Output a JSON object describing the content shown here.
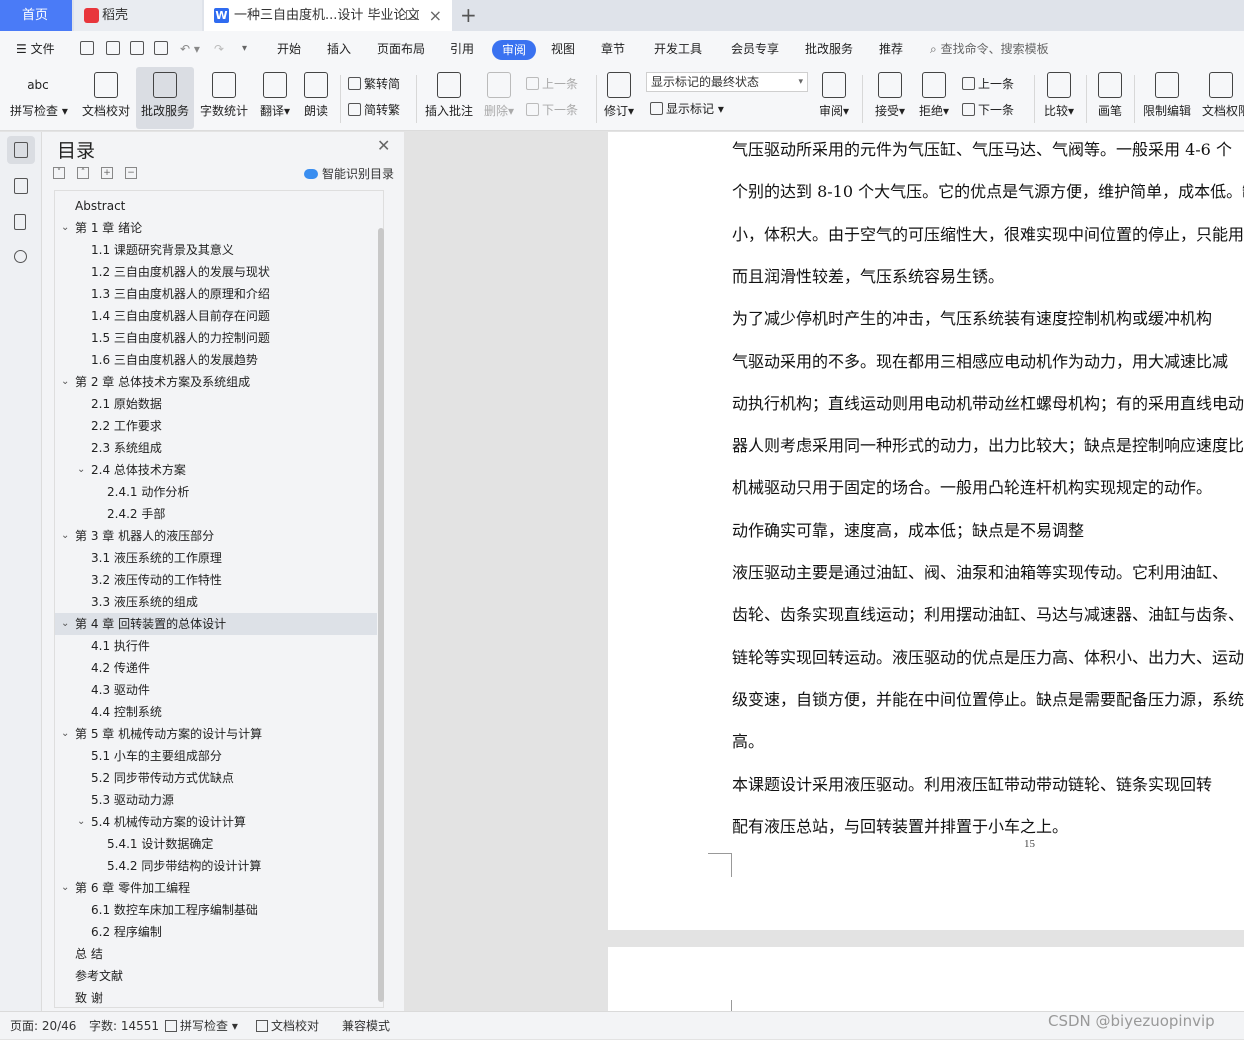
{
  "tabs": {
    "home": "首页",
    "daoke": "稻壳",
    "doc": "一种三自由度机...设计 毕业论文"
  },
  "menu": {
    "file": "文件",
    "items": [
      "开始",
      "插入",
      "页面布局",
      "引用",
      "审阅",
      "视图",
      "章节",
      "开发工具",
      "会员专享",
      "批改服务",
      "推荐"
    ],
    "active_index": 4,
    "search_placeholder": "查找命令、搜索模板"
  },
  "ribbon": {
    "spell": "拼写检查",
    "proof": "文档校对",
    "correct": "批改服务",
    "wordcount": "字数统计",
    "translate": "翻译",
    "read": "朗读",
    "s2t": "繁转简",
    "t2s": "简转繁",
    "insert_comment": "插入批注",
    "delete": "删除",
    "prev": "上一条",
    "next": "下一条",
    "revise": "修订",
    "markup_state": "显示标记的最终状态",
    "show_markup": "显示标记",
    "review": "审阅",
    "accept": "接受",
    "reject": "拒绝",
    "prev2": "上一条",
    "next2": "下一条",
    "compare": "比较",
    "pen": "画笔",
    "restrict": "限制编辑",
    "doc_perm": "文档权限"
  },
  "toc": {
    "title": "目录",
    "smart": "智能识别目录",
    "items": [
      {
        "text": "Abstract",
        "level": 0,
        "arrow": ""
      },
      {
        "text": "第 1 章  绪论",
        "level": 0,
        "arrow": "v"
      },
      {
        "text": "1.1 课题研究背景及其意义",
        "level": 1,
        "arrow": ""
      },
      {
        "text": "1.2 三自由度机器人的发展与现状",
        "level": 1,
        "arrow": ""
      },
      {
        "text": "1.3 三自由度机器人的原理和介绍",
        "level": 1,
        "arrow": ""
      },
      {
        "text": "1.4 三自由度机器人目前存在问题",
        "level": 1,
        "arrow": ""
      },
      {
        "text": "1.5 三自由度机器人的力控制问题",
        "level": 1,
        "arrow": ""
      },
      {
        "text": "1.6 三自由度机器人的发展趋势",
        "level": 1,
        "arrow": ""
      },
      {
        "text": "第 2 章  总体技术方案及系统组成",
        "level": 0,
        "arrow": "v"
      },
      {
        "text": "2.1 原始数据",
        "level": 1,
        "arrow": ""
      },
      {
        "text": "2.2 工作要求",
        "level": 1,
        "arrow": ""
      },
      {
        "text": "2.3 系统组成",
        "level": 1,
        "arrow": ""
      },
      {
        "text": "2.4 总体技术方案",
        "level": 1,
        "arrow": "v"
      },
      {
        "text": "2.4.1  动作分析",
        "level": 2,
        "arrow": ""
      },
      {
        "text": "2.4.2  手部",
        "level": 2,
        "arrow": ""
      },
      {
        "text": "第 3 章  机器人的液压部分",
        "level": 0,
        "arrow": "v"
      },
      {
        "text": "3.1 液压系统的工作原理",
        "level": 1,
        "arrow": ""
      },
      {
        "text": "3.2 液压传动的工作特性",
        "level": 1,
        "arrow": ""
      },
      {
        "text": "3.3 液压系统的组成",
        "level": 1,
        "arrow": ""
      },
      {
        "text": "第 4 章  回转装置的总体设计",
        "level": 0,
        "arrow": "v"
      },
      {
        "text": "4.1 执行件",
        "level": 1,
        "arrow": ""
      },
      {
        "text": "4.2 传递件",
        "level": 1,
        "arrow": ""
      },
      {
        "text": "4.3 驱动件",
        "level": 1,
        "arrow": ""
      },
      {
        "text": "4.4 控制系统",
        "level": 1,
        "arrow": ""
      },
      {
        "text": "第 5 章  机械传动方案的设计与计算",
        "level": 0,
        "arrow": "v"
      },
      {
        "text": "5.1 小车的主要组成部分",
        "level": 1,
        "arrow": ""
      },
      {
        "text": "5.2 同步带传动方式优缺点",
        "level": 1,
        "arrow": ""
      },
      {
        "text": "5.3 驱动动力源",
        "level": 1,
        "arrow": ""
      },
      {
        "text": "5.4 机械传动方案的设计计算",
        "level": 1,
        "arrow": "v"
      },
      {
        "text": "5.4.1 设计数据确定",
        "level": 2,
        "arrow": ""
      },
      {
        "text": "5.4.2 同步带结构的设计计算",
        "level": 2,
        "arrow": ""
      },
      {
        "text": "第 6 章  零件加工编程",
        "level": 0,
        "arrow": "v"
      },
      {
        "text": "6.1 数控车床加工程序编制基础",
        "level": 1,
        "arrow": ""
      },
      {
        "text": "6.2 程序编制",
        "level": 1,
        "arrow": ""
      },
      {
        "text": "总    结",
        "level": 0,
        "arrow": ""
      },
      {
        "text": "参考文献",
        "level": 0,
        "arrow": ""
      },
      {
        "text": "致    谢",
        "level": 0,
        "arrow": ""
      }
    ],
    "selected_index": 19
  },
  "document": {
    "lines": [
      "    气压驱动所采用的元件为气压缸、气压马达、气阀等。一般采用 4-6 个",
      "个别的达到 8-10 个大气压。它的优点是气源方便，维护简单，成本低。缺",
      "小，体积大。由于空气的可压缩性大，很难实现中间位置的停止，只能用于",
      "而且润滑性较差，气压系统容易生锈。",
      "    为了减少停机时产生的冲击，气压系统装有速度控制机构或缓冲机构",
      "    气驱动采用的不多。现在都用三相感应电动机作为动力，用大减速比减",
      "动执行机构；直线运动则用电动机带动丝杠螺母机构；有的采用直线电动",
      "器人则考虑采用同一种形式的动力，出力比较大；缺点是控制响应速度比",
      "    机械驱动只用于固定的场合。一般用凸轮连杆机构实现规定的动作。",
      "动作确实可靠，速度高，成本低；缺点是不易调整",
      "    液压驱动主要是通过油缸、阀、油泵和油箱等实现传动。它利用油缸、",
      "齿轮、齿条实现直线运动；利用摆动油缸、马达与减速器、油缸与齿条、",
      "链轮等实现回转运动。液压驱动的优点是压力高、体积小、出力大、运动平",
      "级变速，自锁方便，并能在中间位置停止。缺点是需要配备压力源，系统复",
      "高。",
      "    本课题设计采用液压驱动。利用液压缸带动带动链轮、链条实现回转",
      "配有液压总站，与回转装置并排置于小车之上。"
    ],
    "page_number": "15"
  },
  "status": {
    "page": "页面: 20/46",
    "words": "字数: 14551",
    "spell": "拼写检查",
    "proof": "文档校对",
    "compat": "兼容模式"
  },
  "watermark": "CSDN @biyezuopinvip"
}
